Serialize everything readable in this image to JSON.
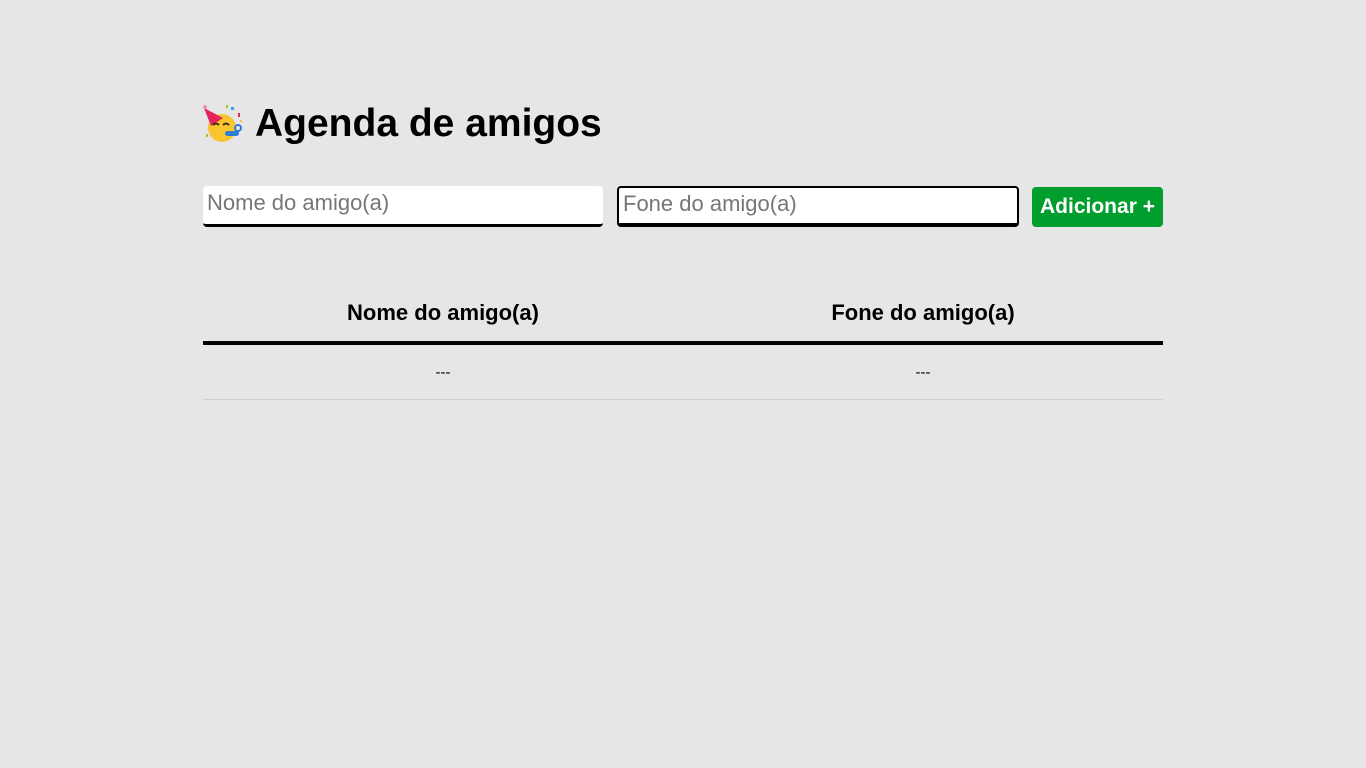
{
  "header": {
    "icon": "partying-face-icon",
    "title": "Agenda de amigos"
  },
  "form": {
    "name_placeholder": "Nome do amigo(a)",
    "phone_placeholder": "Fone do amigo(a)",
    "add_label": "Adicionar +"
  },
  "table": {
    "columns": [
      "Nome do amigo(a)",
      "Fone do amigo(a)"
    ],
    "rows": [
      [
        "---",
        "---"
      ]
    ]
  },
  "colors": {
    "background": "#e6e6e6",
    "accent": "#009e2c"
  }
}
